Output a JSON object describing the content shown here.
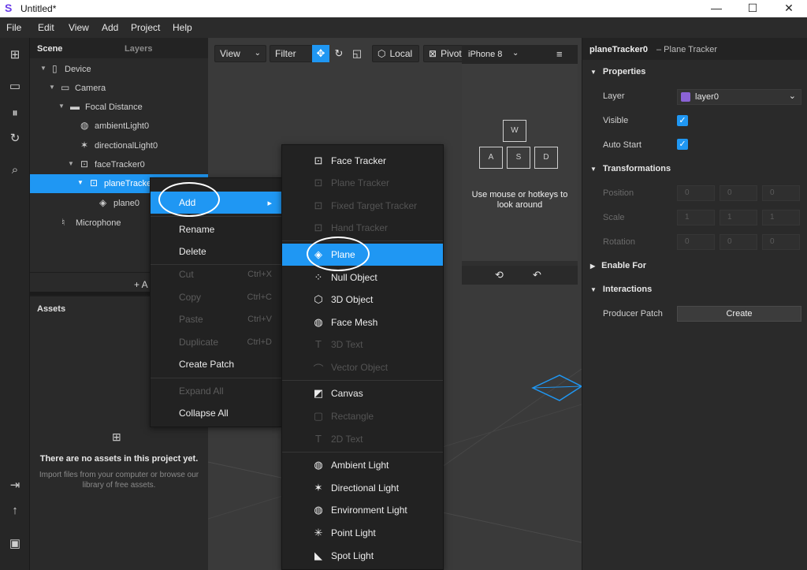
{
  "window": {
    "title": "Untitled*",
    "controls": {
      "minimize": "—",
      "maximize": "☐",
      "close": "✕"
    }
  },
  "menubar": [
    "File",
    "Edit",
    "View",
    "Add",
    "Project",
    "Help"
  ],
  "scene_panel": {
    "tabs": {
      "scene": "Scene",
      "layers": "Layers"
    },
    "tree": [
      "Device",
      "Camera",
      "Focal Distance",
      "ambientLight0",
      "directionalLight0",
      "faceTracker0",
      "planeTracker0",
      "plane0",
      "Microphone"
    ],
    "add_label": "+ A"
  },
  "assets_panel": {
    "header": "Assets",
    "empty_title": "There are no assets in this project yet.",
    "empty_desc": "Import files from your computer or browse our library of free assets."
  },
  "viewport": {
    "toolbar": {
      "view": "View",
      "filter": "Filter",
      "local": "Local",
      "pivot": "Pivot"
    },
    "simulator": {
      "device": "iPhone 8",
      "keys": [
        "W",
        "A",
        "S",
        "D"
      ],
      "hint": "Use mouse or hotkeys to look around"
    }
  },
  "context_menu": [
    {
      "label": "Add",
      "shortcut": "▸",
      "disabled": false
    },
    {
      "label": "Rename",
      "shortcut": "",
      "disabled": false
    },
    {
      "label": "Delete",
      "shortcut": "",
      "disabled": false
    },
    {
      "label": "Cut",
      "shortcut": "Ctrl+X",
      "disabled": true
    },
    {
      "label": "Copy",
      "shortcut": "Ctrl+C",
      "disabled": true
    },
    {
      "label": "Paste",
      "shortcut": "Ctrl+V",
      "disabled": true
    },
    {
      "label": "Duplicate",
      "shortcut": "Ctrl+D",
      "disabled": true
    },
    {
      "label": "Create Patch",
      "shortcut": "",
      "disabled": false
    },
    {
      "label": "Expand All",
      "shortcut": "",
      "disabled": true
    },
    {
      "label": "Collapse All",
      "shortcut": "",
      "disabled": false
    }
  ],
  "submenu": [
    {
      "label": "Face Tracker",
      "icon": "face-tracker-icon",
      "disabled": false
    },
    {
      "label": "Plane Tracker",
      "icon": "plane-tracker-icon",
      "disabled": true
    },
    {
      "label": "Fixed Target Tracker",
      "icon": "target-tracker-icon",
      "disabled": true
    },
    {
      "label": "Hand Tracker",
      "icon": "hand-tracker-icon",
      "disabled": true
    },
    {
      "label": "Plane",
      "icon": "plane-icon",
      "disabled": false
    },
    {
      "label": "Null Object",
      "icon": "null-object-icon",
      "disabled": false
    },
    {
      "label": "3D Object",
      "icon": "cube-icon",
      "disabled": false
    },
    {
      "label": "Face Mesh",
      "icon": "globe-icon",
      "disabled": false
    },
    {
      "label": "3D Text",
      "icon": "text-icon",
      "disabled": true
    },
    {
      "label": "Vector Object",
      "icon": "vector-icon",
      "disabled": true
    },
    {
      "label": "Canvas",
      "icon": "canvas-icon",
      "disabled": false
    },
    {
      "label": "Rectangle",
      "icon": "rectangle-icon",
      "disabled": true
    },
    {
      "label": "2D Text",
      "icon": "text-icon",
      "disabled": true
    },
    {
      "label": "Ambient Light",
      "icon": "globe-icon",
      "disabled": false
    },
    {
      "label": "Directional Light",
      "icon": "directional-light-icon",
      "disabled": false
    },
    {
      "label": "Environment Light",
      "icon": "globe-icon",
      "disabled": false
    },
    {
      "label": "Point Light",
      "icon": "point-light-icon",
      "disabled": false
    },
    {
      "label": "Spot Light",
      "icon": "spot-light-icon",
      "disabled": false
    }
  ],
  "inspector": {
    "object_name": "planeTracker0",
    "object_type": "– Plane Tracker",
    "sections": {
      "properties": "Properties",
      "transformations": "Transformations",
      "enable_for": "Enable For",
      "interactions": "Interactions"
    },
    "fields": {
      "layer_label": "Layer",
      "layer_value": "layer0",
      "visible_label": "Visible",
      "auto_start_label": "Auto Start",
      "position_label": "Position",
      "scale_label": "Scale",
      "rotation_label": "Rotation",
      "position_values": [
        "0",
        "0",
        "0"
      ],
      "scale_values": [
        "1",
        "1",
        "1"
      ],
      "rotation_values": [
        "0",
        "0",
        "0"
      ],
      "producer_patch_label": "Producer Patch",
      "create_label": "Create"
    }
  },
  "colors": {
    "accent": "#1f97f3",
    "layer_swatch": "#8b63d6",
    "panel": "#2a2a2a",
    "viewport": "#3a3a3a"
  }
}
